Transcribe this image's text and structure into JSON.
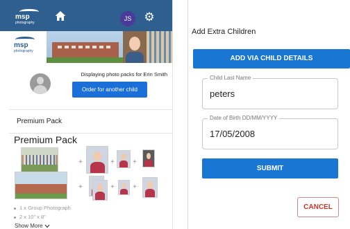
{
  "left_app": {
    "brand": {
      "name": "msp",
      "sub": "photography"
    },
    "user_initials": "JS",
    "displaying_text": "Displaying photo packs for Erin Smith",
    "order_button": "Order for another child",
    "pack_row_label": "Premium Pack",
    "pack_title": "Premium Pack",
    "items": [
      "1 x Group Photograph",
      "2 x 10\" x 8\""
    ],
    "show_more": "Show More",
    "colors": {
      "topbar": "#2e5f8f",
      "primary_button": "#1a6fd8",
      "avatar": "#4a3a9a"
    }
  },
  "dialog": {
    "title": "Add Extra Children",
    "add_via_button": "ADD VIA CHILD DETAILS",
    "fields": [
      {
        "label": "Child Last Name",
        "value": "peters"
      },
      {
        "label": "Date of Birth DD/MM/YYYY",
        "value": "17/05/2008"
      }
    ],
    "submit_button": "SUBMIT",
    "cancel_button": "CANCEL",
    "colors": {
      "primary": "#1976d2",
      "cancel": "#c0392b"
    }
  }
}
